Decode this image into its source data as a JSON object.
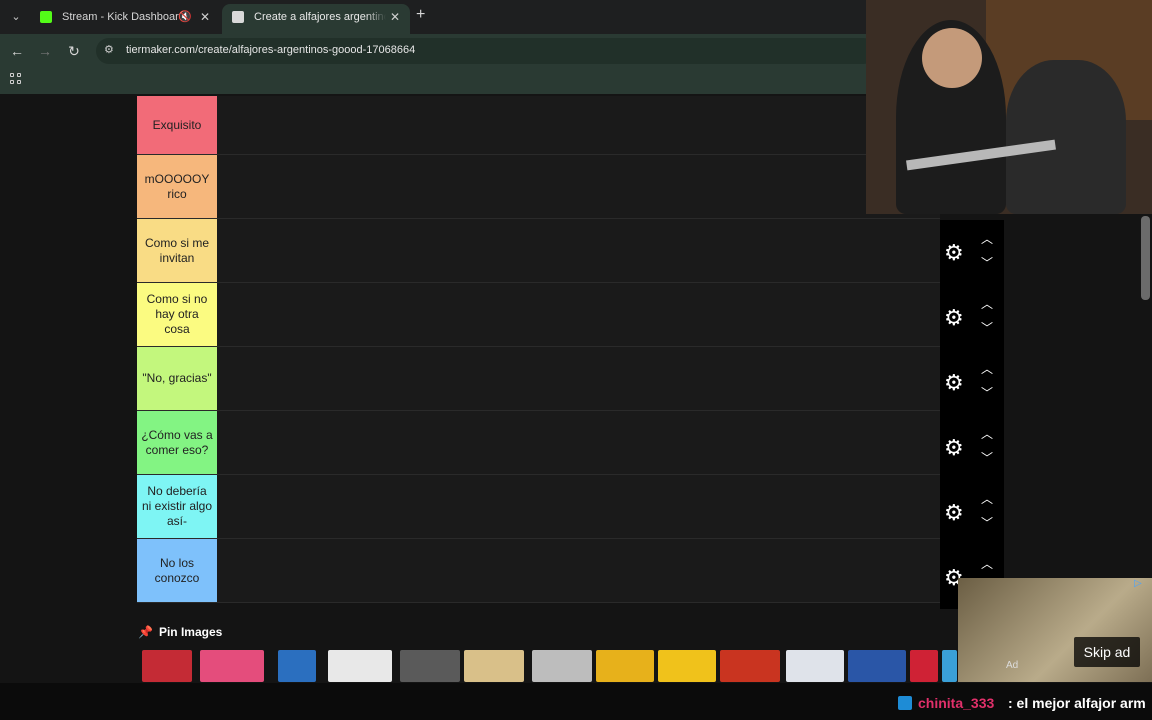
{
  "browser": {
    "tabs": [
      {
        "label": "Stream - Kick Dashboard",
        "favicon": "kick-icon"
      },
      {
        "label": "Create a alfajores argentinos goood",
        "favicon": "tiermaker-icon"
      }
    ],
    "url": "tiermaker.com/create/alfajores-argentinos-goood-17068664"
  },
  "tiers": [
    {
      "label": "Exquisito",
      "color": "#f26b78"
    },
    {
      "label": "mOOOOOY rico",
      "color": "#f6b77c"
    },
    {
      "label": "Como si me invitan",
      "color": "#f9dc85"
    },
    {
      "label": "Como si no hay otra cosa",
      "color": "#fbfb81"
    },
    {
      "label": "\"No, gracias\"",
      "color": "#c3f77d"
    },
    {
      "label": "¿Cómo vas a comer eso?",
      "color": "#83f483"
    },
    {
      "label": "No debería ni existir algo así-",
      "color": "#7ef5f4"
    },
    {
      "label": "No los conozco",
      "color": "#7ec1fb"
    }
  ],
  "pin_images": {
    "title": "Pin Images",
    "thumb_colors": [
      "#c42b35",
      "#e44d7c",
      "#2b6fbf",
      "#e8e8e8",
      "#5a5a5a",
      "#d9c089",
      "#bdbdbd",
      "#e7b11b",
      "#f0c21b",
      "#c93420",
      "#dfe3ea",
      "#2a56a7",
      "#cf2235",
      "#3aa0d8"
    ]
  },
  "ad": {
    "skip_label": "Skip ad",
    "ad_text": "Ad"
  },
  "chat": {
    "user": "chinita_333",
    "message": ": el mejor alfajor arm"
  }
}
